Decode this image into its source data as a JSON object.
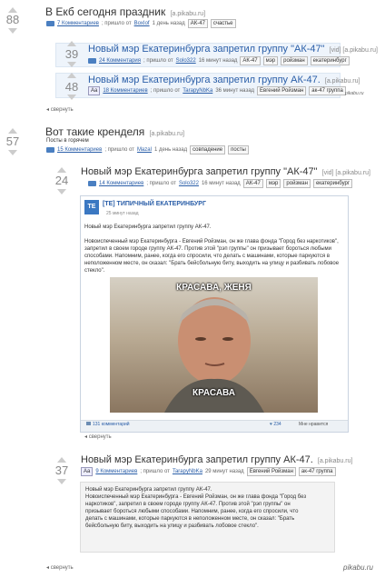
{
  "post1": {
    "rating": "88",
    "title": "В Екб сегодня праздник",
    "domain": "[a.pikabu.ru]",
    "comments": "7 Комментариев",
    "posted_by_pre": "; пришло от",
    "author": "BoxIof",
    "time": "1 день назад",
    "tags": [
      "АК-47",
      "счастье"
    ],
    "collapse": "свернуть"
  },
  "sub1": {
    "rating": "39",
    "title": "Новый мэр Екатеринбурга запретил группу \"АК-47\"",
    "domain": "[vid] [a.pikabu.ru]",
    "comments": "24 Комментария",
    "author": "Solo322",
    "time": "16 минут назад",
    "tags": [
      "АК-47",
      "мэр",
      "ройзман",
      "екатеринбург"
    ]
  },
  "sub2": {
    "rating": "48",
    "title": "Новый мэр Екатеринбурга запретил группу АК-47.",
    "domain": "[a.pikabu.ru]",
    "aa": "Aa",
    "comments": "18 Комментариев",
    "author": "TarapyNbKa",
    "time": "36 минут назад",
    "tags": [
      "Евгений Ройзман",
      "ак-47 группа"
    ],
    "logo": "pikabu.ru"
  },
  "post2": {
    "rating": "57",
    "title": "Вот такие кренделя",
    "domain": "[a.pikabu.ru]",
    "subline": "Посты в горячем",
    "comments": "15 Комментариев",
    "author": "Mazal",
    "time": "1 день назад",
    "tags": [
      "совпадение",
      "посты"
    ],
    "collapse": "свернуть"
  },
  "sub3": {
    "rating": "24",
    "title": "Новый мэр Екатеринбурга запретил группу \"АК-47\"",
    "domain": "[vid] [a.pikabu.ru]",
    "comments": "14 Комментариев",
    "author": "Solo322",
    "time": "16 минут назад",
    "tags": [
      "АК-47",
      "мэр",
      "ройзман",
      "екатеринбург"
    ]
  },
  "vk": {
    "group_name": "[TE] ТИПИЧНЫЙ ЕКАТЕРИНБУРГ",
    "group_time": "25 минут назад",
    "logo_text": "TE",
    "headline": "Новый мэр Екатеринбурга запретил группу АК-47.",
    "body": "Новоиспеченный мэр Екатеринбурга - Евгений Ройзман, он же глава фонда \"Город без наркотиков\", запретил в своем городе группу АК-47. Против этой \"рэп группы\" он призывает бороться любыми способами. Напомним, ранее, когда его спросили, что делать с машинами, которые паркуются в неположенном месте, он сказал: \"Брать бейсбольную биту, выходить на улицу и разбивать лобовое стекло\".",
    "meme_top": "КРАСАВА, ЖЕНЯ",
    "meme_bottom": "КРАСАВА",
    "comments_count": "131 комментарий",
    "likes": "234",
    "share": "Мне нравится"
  },
  "sub4": {
    "rating": "37",
    "title": "Новый мэр Екатеринбурга запретил группу АК-47.",
    "domain": "[a.pikabu.ru]",
    "aa": "Aa",
    "comments": "9 Комментариев",
    "author": "TarapyNbKa",
    "time": "29 минут назад",
    "tags": [
      "Евгений Ройзман",
      "ак-47 группа"
    ],
    "text": "Новый мэр Екатеринбурга запретил группу АК-47.\nНовоиспеченный мэр Екатеринбурга - Евгений Ройзман, он же глава фонда \"Город без наркотиков\", запретил в своем городе группу АК-47. Против этой \"рэп группы\" он призывает бороться любыми способами. Напомним, ранее, когда его спросили, что делать с машинами, которые паркуются в неположенном месте, он сказал: \"Брать бейсбольную биту, выходить на улицу и разбивать лобовое стекло\".",
    "collapse": "свернуть"
  },
  "footer": {
    "collapse": "свернуть",
    "watermark": "pikabu.ru"
  }
}
